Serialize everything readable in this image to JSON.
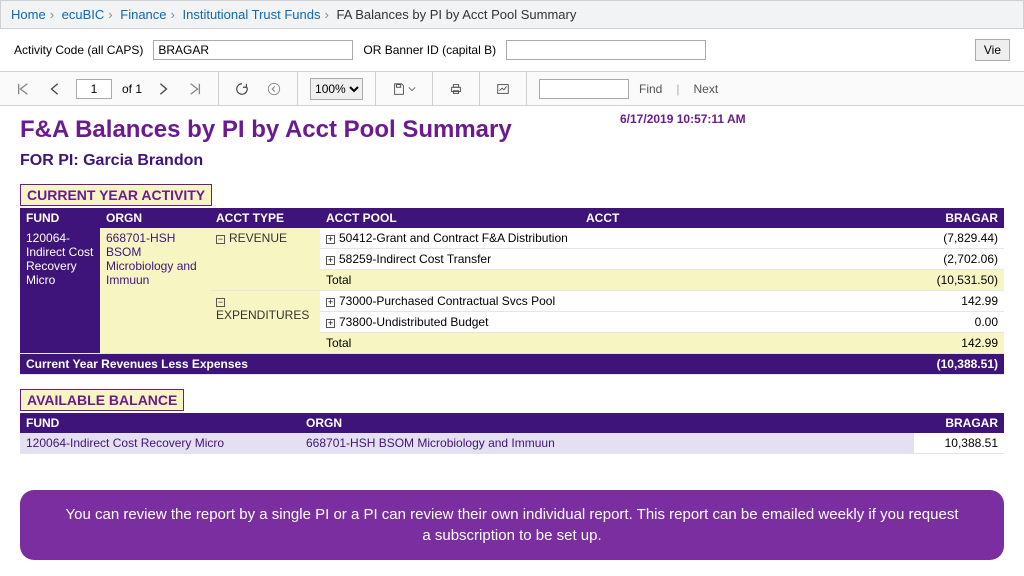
{
  "breadcrumb": {
    "items": [
      "Home",
      "ecuBIC",
      "Finance",
      "Institutional Trust Funds"
    ],
    "current": "FA Balances by PI by Acct Pool Summary"
  },
  "filters": {
    "activity_label": "Activity Code (all CAPS)",
    "activity_value": "BRAGAR",
    "banner_label": "OR Banner ID (capital B)",
    "banner_value": "",
    "view_label": "Vie"
  },
  "toolbar": {
    "page_value": "1",
    "page_of": "of 1",
    "zoom": "100%",
    "find_value": "",
    "find_label": "Find",
    "next_label": "Next"
  },
  "report": {
    "title": "F&A Balances by PI by Acct Pool Summary",
    "timestamp": "6/17/2019 10:57:11 AM",
    "pi_line": "FOR PI: Garcia Brandon",
    "section_current": "CURRENT YEAR ACTIVITY",
    "section_available": "AVAILABLE BALANCE",
    "headers": {
      "fund": "FUND",
      "orgn": "ORGN",
      "acct_type": "ACCT TYPE",
      "acct_pool": "ACCT POOL",
      "acct": "ACCT",
      "bragar": "BRAGAR"
    },
    "fund": "120064-Indirect  Cost Recovery  Micro",
    "orgn": "668701-HSH BSOM Microbiology and Immuun",
    "types": {
      "rev": {
        "label": "REVENUE",
        "rows": [
          {
            "pool": "50412-Grant and Contract F&A Distribution",
            "val": "(7,829.44)"
          },
          {
            "pool": "58259-Indirect Cost Transfer",
            "val": "(2,702.06)"
          }
        ],
        "total_label": "Total",
        "total_val": "(10,531.50)"
      },
      "exp": {
        "label": "EXPENDITURES",
        "rows": [
          {
            "pool": "73000-Purchased Contractual Svcs Pool",
            "val": "142.99"
          },
          {
            "pool": "73800-Undistributed Budget",
            "val": "0.00"
          }
        ],
        "total_label": "Total",
        "total_val": "142.99"
      }
    },
    "grand_label": "Current Year Revenues Less Expenses",
    "grand_val": "(10,388.51)",
    "available": {
      "fund": "120064-Indirect  Cost Recovery  Micro",
      "orgn": "668701-HSH BSOM Microbiology and Immuun",
      "val": "10,388.51"
    }
  },
  "note": "You can review the report by a single PI or a PI can review their own individual report. This report can be emailed weekly if you request a subscription to be set up."
}
